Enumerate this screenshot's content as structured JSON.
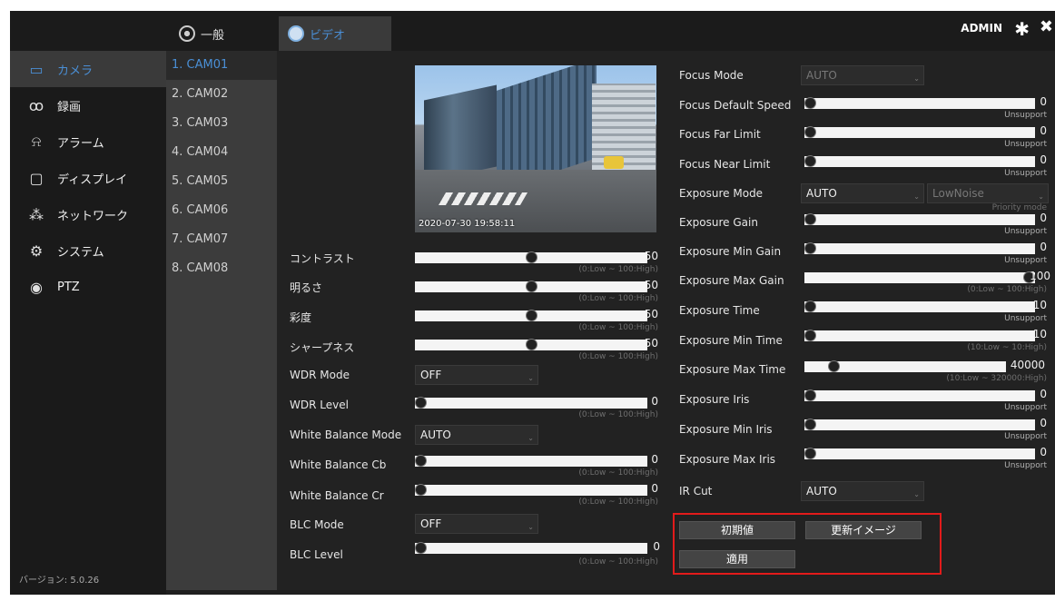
{
  "topbar": {
    "tab_general": "一般",
    "tab_video": "ビデオ",
    "user": "ADMIN"
  },
  "menu": {
    "items": [
      {
        "label": "カメラ",
        "icon": "camera-icon"
      },
      {
        "label": "録画",
        "icon": "tape-icon"
      },
      {
        "label": "アラーム",
        "icon": "alarm-icon"
      },
      {
        "label": "ディスプレイ",
        "icon": "monitor-icon"
      },
      {
        "label": "ネットワーク",
        "icon": "network-icon"
      },
      {
        "label": "システム",
        "icon": "gear-icon"
      },
      {
        "label": "PTZ",
        "icon": "ptz-icon"
      }
    ],
    "version": "バージョン: 5.0.26"
  },
  "cameras": [
    "1. CAM01",
    "2. CAM02",
    "3. CAM03",
    "4. CAM04",
    "5. CAM05",
    "6. CAM06",
    "7. CAM07",
    "8. CAM08"
  ],
  "preview": {
    "timestamp": "2020-07-30 19:58:11"
  },
  "left_params": {
    "contrast": {
      "label": "コントラスト",
      "value": "50",
      "hint": "(0:Low ~ 100:High)",
      "level": 0.5
    },
    "brightness": {
      "label": "明るさ",
      "value": "50",
      "hint": "(0:Low ~ 100:High)",
      "level": 0.5
    },
    "saturation": {
      "label": "彩度",
      "value": "50",
      "hint": "(0:Low ~ 100:High)",
      "level": 0.5
    },
    "sharpness": {
      "label": "シャープネス",
      "value": "50",
      "hint": "(0:Low ~ 100:High)",
      "level": 0.5
    },
    "wdr_mode": {
      "label": "WDR Mode",
      "value": "OFF"
    },
    "wdr_level": {
      "label": "WDR Level",
      "value": "0",
      "hint": "(0:Low ~ 100:High)",
      "level": 0
    },
    "wb_mode": {
      "label": "White Balance Mode",
      "value": "AUTO"
    },
    "wb_cb": {
      "label": "White Balance Cb",
      "value": "0",
      "hint": "(0:Low ~ 100:High)",
      "level": 0
    },
    "wb_cr": {
      "label": "White Balance Cr",
      "value": "0",
      "hint": "(0:Low ~ 100:High)",
      "level": 0
    },
    "blc_mode": {
      "label": "BLC Mode",
      "value": "OFF"
    },
    "blc_level": {
      "label": "BLC Level",
      "value": "0",
      "hint": "(0:Low ~ 100:High)",
      "level": 0
    }
  },
  "right_params": {
    "focus_mode": {
      "label": "Focus Mode",
      "value": "AUTO"
    },
    "focus_default_speed": {
      "label": "Focus Default Speed",
      "value": "0",
      "hint": "Unsupport",
      "level": 0
    },
    "focus_far_limit": {
      "label": "Focus Far Limit",
      "value": "0",
      "hint": "Unsupport",
      "level": 0
    },
    "focus_near_limit": {
      "label": "Focus Near Limit",
      "value": "0",
      "hint": "Unsupport",
      "level": 0
    },
    "exposure_mode": {
      "label": "Exposure Mode",
      "value": "AUTO",
      "secondary": "LowNoise",
      "hint": "Priority mode"
    },
    "exposure_gain": {
      "label": "Exposure Gain",
      "value": "0",
      "hint": "Unsupport",
      "level": 0
    },
    "exposure_min_gain": {
      "label": "Exposure Min Gain",
      "value": "0",
      "hint": "Unsupport",
      "level": 0
    },
    "exposure_max_gain": {
      "label": "Exposure Max Gain",
      "value": "100",
      "hint": "(0:Low ~ 100:High)",
      "level": 1
    },
    "exposure_time": {
      "label": "Exposure Time",
      "value": "10",
      "hint": "Unsupport",
      "level": 0
    },
    "exposure_min_time": {
      "label": "Exposure Min Time",
      "value": "10",
      "hint": "(10:Low ~ 10:High)",
      "level": 0
    },
    "exposure_max_time": {
      "label": "Exposure Max Time",
      "value": "40000",
      "hint": "(10:Low ~ 320000:High)",
      "level": 0.125
    },
    "exposure_iris": {
      "label": "Exposure Iris",
      "value": "0",
      "hint": "Unsupport",
      "level": 0
    },
    "exposure_min_iris": {
      "label": "Exposure Min Iris",
      "value": "0",
      "hint": "Unsupport",
      "level": 0
    },
    "exposure_max_iris": {
      "label": "Exposure Max Iris",
      "value": "0",
      "hint": "Unsupport",
      "level": 0
    },
    "ir_cut": {
      "label": "IR Cut",
      "value": "AUTO"
    }
  },
  "buttons": {
    "default": "初期値",
    "refresh_image": "更新イメージ",
    "apply": "適用"
  }
}
